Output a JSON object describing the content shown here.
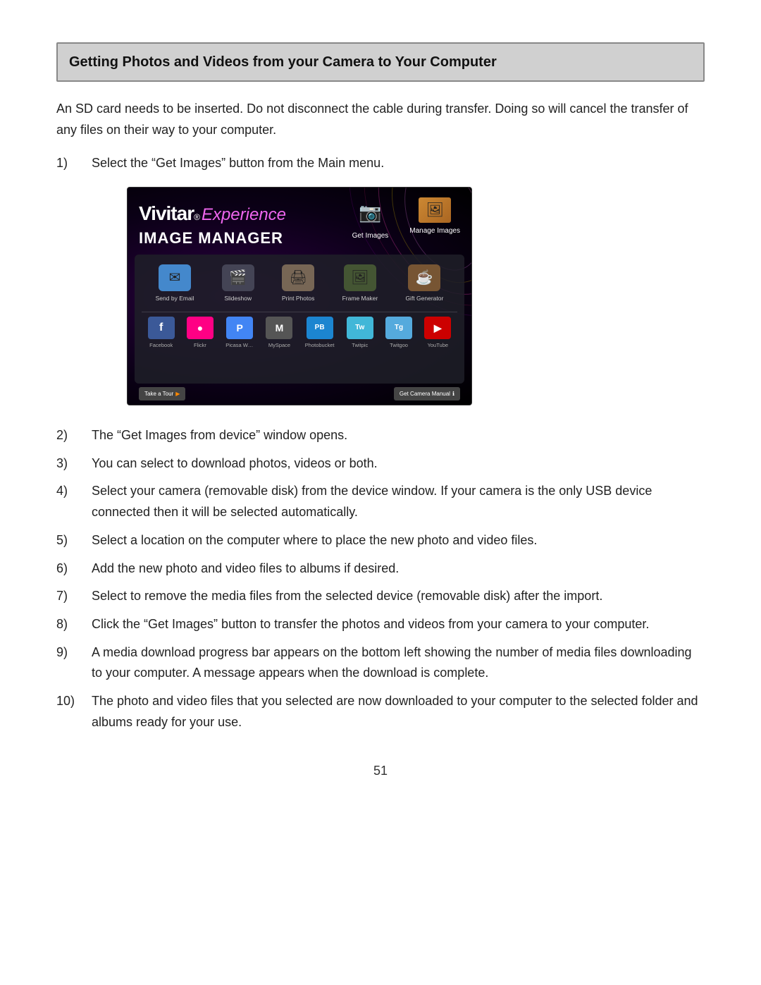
{
  "page": {
    "number": "51"
  },
  "header": {
    "title": "Getting Photos and Videos from your Camera to Your Computer"
  },
  "intro": {
    "text": "An SD card needs to be inserted. Do not disconnect the cable during transfer. Doing so will cancel the transfer of any files on their way to your computer."
  },
  "steps": [
    {
      "num": "1)",
      "text": "Select the “Get Images” button from the Main menu."
    },
    {
      "num": "2)",
      "text": "The “Get Images from device” window opens."
    },
    {
      "num": "3)",
      "text": "You can select to download photos, videos or both."
    },
    {
      "num": "4)",
      "text": "Select your camera (removable disk) from the device window. If your camera is the only USB device connected then it will be selected automatically."
    },
    {
      "num": "5)",
      "text": "Select a location on the computer where to place the new photo and video files."
    },
    {
      "num": "6)",
      "text": "Add the new photo and video files to albums if desired."
    },
    {
      "num": "7)",
      "text": "Select to remove the media files from the selected device (removable disk) after the import."
    },
    {
      "num": "8)",
      "text": "Click the “Get Images” button to transfer the photos and videos from your camera to your computer."
    },
    {
      "num": "9)",
      "text": "A media download progress bar appears on the bottom left showing the number of media files downloading to your computer. A message appears when the download is complete."
    },
    {
      "num": "10)",
      "text": "The photo and video files that you selected are now downloaded to your computer to the selected folder and albums ready for your use."
    }
  ],
  "screenshot": {
    "vivitar_bold": "Vivitar",
    "vivitar_italic": "Experience",
    "image_manager": "IMAGE MANAGER",
    "top_icons": [
      {
        "label": "Get Images",
        "icon": "📷"
      },
      {
        "label": "Manage Images",
        "icon": "🖼"
      }
    ],
    "app_icons": [
      {
        "label": "Send by Email",
        "icon": "✉",
        "color": "#4488cc"
      },
      {
        "label": "Slideshow",
        "icon": "🎬",
        "color": "#555566"
      },
      {
        "label": "Print Photos",
        "icon": "🖨",
        "color": "#887766"
      },
      {
        "label": "Frame Maker",
        "icon": "🖼",
        "color": "#556644"
      },
      {
        "label": "Gift Generator",
        "icon": "☕",
        "color": "#886644"
      }
    ],
    "social_icons": [
      {
        "label": "Facebook",
        "icon": "f",
        "color": "#3b5998"
      },
      {
        "label": "Flickr",
        "icon": "●",
        "color": "#ff0084"
      },
      {
        "label": "Picasa Web Albums",
        "icon": "P",
        "color": "#4285f4"
      },
      {
        "label": "MySpace",
        "icon": "M",
        "color": "#666"
      },
      {
        "label": "Photobucket",
        "icon": "P",
        "color": "#1c85d0"
      },
      {
        "label": "Twitpic",
        "icon": "T",
        "color": "#41b7d8"
      },
      {
        "label": "Twitgoo",
        "icon": "T",
        "color": "#55aadd"
      },
      {
        "label": "YouTube",
        "icon": "▶",
        "color": "#cc0000"
      }
    ],
    "tour_btn": "Take a Tour",
    "manual_btn": "Get Camera Manual"
  }
}
